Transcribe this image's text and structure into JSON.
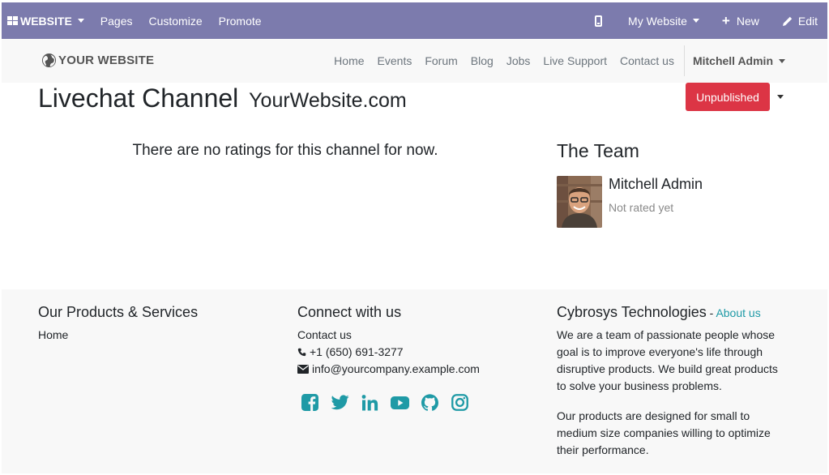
{
  "admin_bar": {
    "brand_label": "WEBSITE",
    "menu": [
      "Pages",
      "Customize",
      "Promote"
    ],
    "website_selector": "My Website",
    "new_label": "New",
    "edit_label": "Edit"
  },
  "header": {
    "logo_text": "YOUR WEBSITE",
    "nav": [
      "Home",
      "Events",
      "Forum",
      "Blog",
      "Jobs",
      "Live Support",
      "Contact us"
    ],
    "user": "Mitchell Admin"
  },
  "main": {
    "title": "Livechat Channel",
    "subtitle": "YourWebsite.com",
    "publish_label": "Unpublished",
    "no_ratings": "There are no ratings for this channel for now.",
    "team_title": "The Team",
    "member": {
      "name": "Mitchell Admin",
      "rating": "Not rated yet"
    }
  },
  "footer": {
    "products": {
      "title": "Our Products & Services",
      "link": "Home"
    },
    "connect": {
      "title": "Connect with us",
      "link": "Contact us",
      "phone": "+1 (650) 691-3277",
      "email": "info@yourcompany.example.com",
      "socials": [
        "facebook-icon",
        "twitter-icon",
        "linkedin-icon",
        "youtube-icon",
        "github-icon",
        "instagram-icon"
      ]
    },
    "about": {
      "company": "Cybrosys Technologies",
      "separator": " - ",
      "link": "About us",
      "para1": "We are a team of passionate people whose goal is to improve everyone's life through disruptive products. We build great products to solve your business problems.",
      "para2": "Our products are designed for small to medium size companies willing to optimize their performance."
    }
  },
  "colors": {
    "admin_bar": "#7c7bad",
    "publish_button": "#dc3545",
    "link": "#1f9aa6"
  }
}
